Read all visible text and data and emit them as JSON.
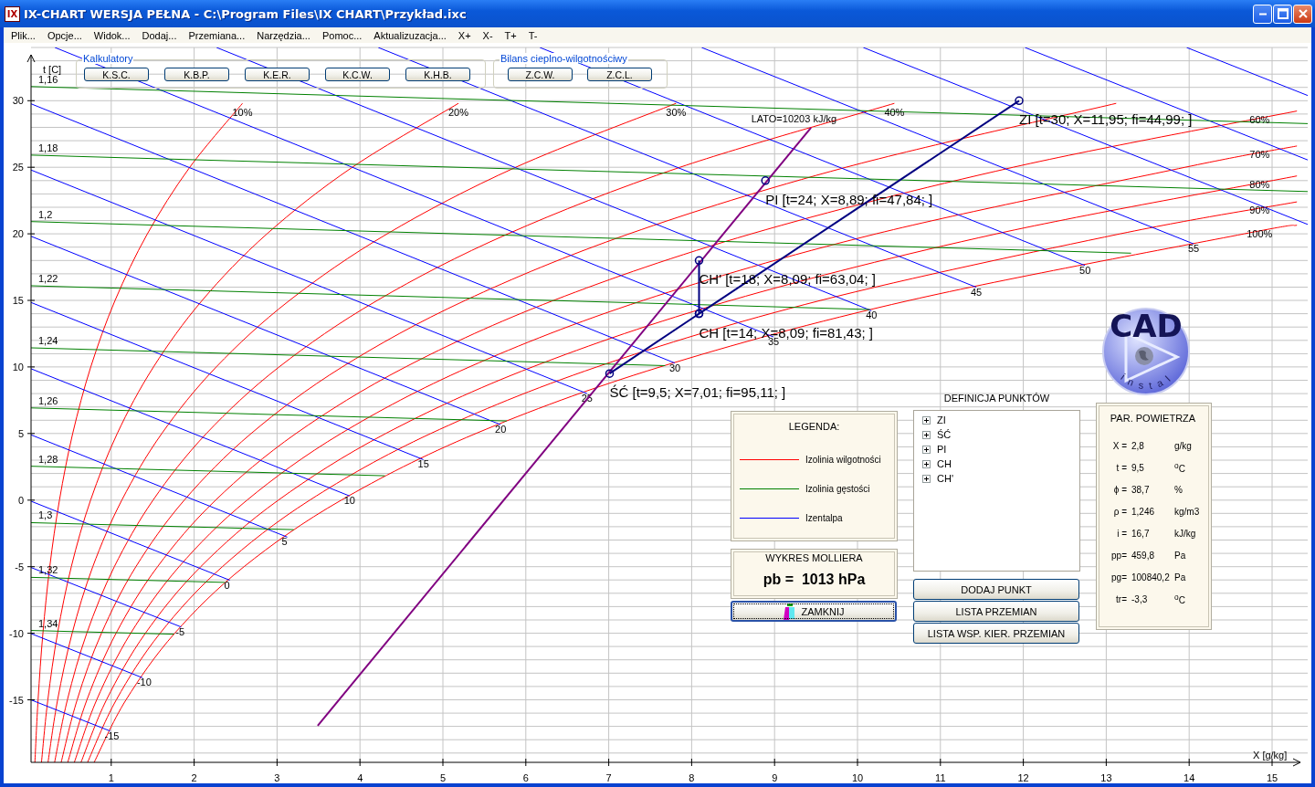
{
  "window": {
    "icon_text": "IX",
    "title": "IX-CHART WERSJA PEŁNA - C:\\Program Files\\IX CHART\\Przykład.ixc"
  },
  "menu": [
    "Plik...",
    "Opcje...",
    "Widok...",
    "Dodaj...",
    "Przemiana...",
    "Narzędzia...",
    "Pomoc...",
    "Aktualizuzacja...",
    "X+",
    "X-",
    "T+",
    "T-"
  ],
  "chart": {
    "chart_data": {
      "type": "line",
      "xlabel": "X [g/kg]",
      "ylabel": "t [C]",
      "xlim": [
        0,
        15.43
      ],
      "ylim": [
        -19.7,
        34
      ],
      "grid": true,
      "xticks": [
        1,
        2,
        3,
        4,
        5,
        6,
        7,
        8,
        9,
        10,
        11,
        12,
        13,
        14,
        15
      ],
      "yticks": [
        -15,
        -10,
        -5,
        0,
        5,
        10,
        15,
        20,
        25,
        30
      ],
      "series": [
        {
          "name": "10%",
          "color": "#ff0000",
          "x": [
            2.583,
            1.9475,
            1.4361,
            1.0468,
            0.7537,
            0.5357,
            0.3753,
            0.2592,
            0.1761,
            0.1177,
            0.0793
          ],
          "values": [
            29.8,
            25,
            20,
            15,
            10,
            5,
            0,
            -5,
            -10,
            -15,
            -19.7
          ]
        },
        {
          "name": "20%",
          "color": "#ff0000",
          "x": [
            5.187,
            3.9072,
            2.8787,
            2.0971,
            1.5101,
            1.0722,
            0.7511,
            0.5186,
            0.3524,
            0.2355,
            0.1586
          ],
          "values": [
            29.8,
            25,
            20,
            15,
            10,
            5,
            0,
            -5,
            -10,
            -15,
            -19.7
          ]
        },
        {
          "name": "30%",
          "color": "#ff0000",
          "x": [
            7.812,
            5.879,
            4.328,
            3.151,
            2.2667,
            1.6098,
            1.1274,
            0.7781,
            0.5288,
            0.3533,
            0.2379
          ],
          "values": [
            29.8,
            25,
            20,
            15,
            10,
            5,
            0,
            -5,
            -10,
            -15,
            -19.7
          ]
        },
        {
          "name": "40%",
          "color": "#ff0000",
          "x": [
            10.445,
            7.8606,
            5.785,
            4.2089,
            3.0256,
            2.1481,
            1.504,
            1.0379,
            0.7052,
            0.4712,
            0.3172
          ],
          "values": [
            29.8,
            25,
            20,
            15,
            10,
            5,
            0,
            -5,
            -10,
            -15,
            -19.7
          ]
        },
        {
          "color": "#ff0000",
          "x": [
            13.12,
            9.8615,
            7.2466,
            5.2695,
            3.7867,
            2.6874,
            1.8811,
            1.2979,
            0.8817,
            0.5891,
            0.3966
          ],
          "values": [
            29.8,
            25,
            20,
            15,
            10,
            5,
            0,
            -5,
            -10,
            -15,
            -19.7
          ]
        },
        {
          "name": "60%",
          "color": "#ff0000",
          "x": [
            15.3,
            11.878,
            8.7218,
            6.3366,
            4.5507,
            3.2282,
            2.2588,
            1.5581,
            1.0583,
            0.7071,
            0.476
          ],
          "values": [
            29.23,
            25,
            20,
            15,
            10,
            5,
            0,
            -5,
            -10,
            -15,
            -19.7
          ]
        },
        {
          "name": "70%",
          "color": "#ff0000",
          "x": [
            15.3,
            13.952,
            10.225,
            7.4158,
            5.3201,
            3.771,
            2.6373,
            1.8184,
            1.2351,
            0.8251,
            0.5555
          ],
          "values": [
            26.6,
            25,
            20,
            15,
            10,
            5,
            0,
            -5,
            -10,
            -15,
            -19.7
          ]
        },
        {
          "name": "80%",
          "color": "#ff0000",
          "x": [
            15.3,
            11.677,
            8.474,
            6.081,
            4.311,
            3.0154,
            2.0793,
            1.4121,
            0.9431,
            0.635
          ],
          "values": [
            24.35,
            20,
            15,
            10,
            5,
            0,
            -5,
            -10,
            -15,
            -19.7
          ]
        },
        {
          "name": "90%",
          "color": "#ff0000",
          "x": [
            15.3,
            13.169,
            9.5585,
            6.8573,
            4.8542,
            3.3942,
            2.3401,
            1.5891,
            1.0613,
            0.7144
          ],
          "values": [
            22.4,
            20,
            15,
            10,
            5,
            0,
            -5,
            -10,
            -15,
            -19.7
          ]
        },
        {
          "name": "100%",
          "color": "#ff0000",
          "x": [
            15.3,
            14.665,
            10.629,
            7.62,
            5.398,
            3.774,
            2.601,
            1.766,
            1.179,
            0.794
          ],
          "values": [
            20.65,
            20,
            15,
            10,
            5,
            0,
            -5,
            -10,
            -15,
            -19.7
          ]
        },
        {
          "name": "-15",
          "color": "#0000ff",
          "x": [
            0.987,
            0
          ],
          "values": [
            -17.35,
            -14.93
          ]
        },
        {
          "name": "-10",
          "color": "#0000ff",
          "x": [
            1.376,
            0
          ],
          "values": [
            -13.34,
            -9.95
          ]
        },
        {
          "name": "-5",
          "color": "#0000ff",
          "x": [
            1.843,
            0
          ],
          "values": [
            -9.53,
            -4.98
          ]
        },
        {
          "name": "0",
          "color": "#0000ff",
          "x": [
            2.43,
            0
          ],
          "values": [
            -6.02,
            0
          ]
        },
        {
          "name": "5",
          "color": "#0000ff",
          "x": [
            3.123,
            0
          ],
          "values": [
            -2.78,
            4.98
          ]
        },
        {
          "name": "10",
          "color": "#0000ff",
          "x": [
            3.873,
            0
          ],
          "values": [
            0.31,
            9.95
          ]
        },
        {
          "name": "15",
          "color": "#0000ff",
          "x": [
            4.765,
            0
          ],
          "values": [
            3.04,
            14.93
          ]
        },
        {
          "name": "20",
          "color": "#0000ff",
          "x": [
            5.695,
            0
          ],
          "values": [
            5.67,
            19.9
          ]
        },
        {
          "name": "25",
          "color": "#0000ff",
          "x": [
            6.737,
            0
          ],
          "values": [
            8.01,
            24.88
          ]
        },
        {
          "name": "30",
          "color": "#0000ff",
          "x": [
            7.797,
            0
          ],
          "values": [
            10.3,
            29.85
          ]
        },
        {
          "name": "35",
          "color": "#0000ff",
          "x": [
            8.986,
            0.32
          ],
          "values": [
            12.26,
            34
          ]
        },
        {
          "name": "40",
          "color": "#0000ff",
          "x": [
            10.168,
            2.27
          ],
          "values": [
            14.23,
            34
          ]
        },
        {
          "name": "45",
          "color": "#0000ff",
          "x": [
            11.432,
            4.22
          ],
          "values": [
            15.99,
            34
          ]
        },
        {
          "name": "50",
          "color": "#0000ff",
          "x": [
            12.744,
            6.17
          ],
          "values": [
            17.62,
            34
          ]
        },
        {
          "name": "55",
          "color": "#0000ff",
          "x": [
            14.053,
            8.12
          ],
          "values": [
            19.25,
            34
          ]
        },
        {
          "color": "#0000ff",
          "x": [
            15.43,
            10.07
          ],
          "values": [
            20.71,
            34
          ]
        },
        {
          "color": "#0000ff",
          "x": [
            15.43,
            12.02
          ],
          "values": [
            25.55,
            34
          ]
        },
        {
          "color": "#0000ff",
          "x": [
            15.43,
            13.97
          ],
          "values": [
            30.39,
            34
          ]
        },
        {
          "name": "1,16",
          "color": "#008000",
          "x": [
            0,
            15.43
          ],
          "values": [
            31.07,
            28.28
          ]
        },
        {
          "name": "1,18",
          "color": "#008000",
          "x": [
            0,
            15.43
          ],
          "values": [
            25.92,
            23.18
          ]
        },
        {
          "name": "1,2",
          "color": "#008000",
          "x": [
            0,
            13.3
          ],
          "values": [
            20.93,
            18.55
          ]
        },
        {
          "name": "1,22",
          "color": "#008000",
          "x": [
            0,
            10.15
          ],
          "values": [
            16.11,
            14.32
          ]
        },
        {
          "name": "1,24",
          "color": "#008000",
          "x": [
            0,
            7.68
          ],
          "values": [
            11.44,
            10.1
          ]
        },
        {
          "name": "1,26",
          "color": "#008000",
          "x": [
            0,
            5.77
          ],
          "values": [
            6.93,
            5.94
          ]
        },
        {
          "name": "1,28",
          "color": "#008000",
          "x": [
            0,
            4.3
          ],
          "values": [
            2.55,
            1.83
          ]
        },
        {
          "name": "1,3",
          "color": "#008000",
          "x": [
            0,
            3.2
          ],
          "values": [
            -1.69,
            -2.22
          ]
        },
        {
          "name": "1,32",
          "color": "#008000",
          "x": [
            0,
            2.37
          ],
          "values": [
            -5.8,
            -6.18
          ]
        },
        {
          "name": "1,34",
          "color": "#008000",
          "x": [
            0,
            1.755
          ],
          "values": [
            -9.79,
            -10.07
          ]
        },
        {
          "color": "#800080",
          "marker": "none",
          "x": [
            3.49,
            9.44
          ],
          "values": [
            -16.94,
            27.98
          ]
        },
        {
          "color": "#000080",
          "marker": "circle",
          "x": [
            11.95,
            8.09,
            7.01
          ],
          "values": [
            30,
            14,
            9.5
          ]
        },
        {
          "color": "#000080",
          "marker": "circle",
          "x": [
            8.09,
            8.09
          ],
          "values": [
            14,
            18
          ]
        },
        {
          "color": "#000080",
          "marker": "circle",
          "x": [
            8.89
          ],
          "values": [
            24
          ]
        }
      ],
      "annotations": [
        {
          "text": "ZI [t=30; X=11,95; fi=44,99; ]",
          "x": 11.95,
          "y": 30
        },
        {
          "text": "PI [t=24; X=8,89; fi=47,84; ]",
          "x": 8.89,
          "y": 24
        },
        {
          "text": "CH' [t=18; X=8,09; fi=63,04; ]",
          "x": 8.09,
          "y": 18
        },
        {
          "text": "CH [t=14; X=8,09; fi=81,43; ]",
          "x": 8.09,
          "y": 14
        },
        {
          "text": "ŚĆ [t=9,5; X=7,01; fi=95,11; ]",
          "x": 7.01,
          "y": 9.5
        },
        "LATO=10203 kJ/kg"
      ]
    }
  },
  "calculators": {
    "title": "Kalkulatory",
    "buttons": [
      "K.S.C.",
      "K.B.P.",
      "K.E.R.",
      "K.C.W.",
      "K.H.B."
    ]
  },
  "balance": {
    "title": "Bilans cieplno-wilgotnościwy",
    "buttons": [
      "Z.C.W.",
      "Z.C.L."
    ]
  },
  "logo": {
    "title": "CAD",
    "subtitle": "instal"
  },
  "legend": {
    "title": "LEGENDA:",
    "items": [
      {
        "label": "Izolinia wilgotności",
        "color": "#ff0000"
      },
      {
        "label": "Izolinia gęstości",
        "color": "#008000"
      },
      {
        "label": "Izentalpa",
        "color": "#0000ff"
      }
    ]
  },
  "diagram": {
    "title": "WYKRES MOLLIERA",
    "value": "pb =  1013 hPa"
  },
  "close_button": {
    "label": "ZAMKNIJ"
  },
  "points": {
    "title": "DEFINICJA PUNKTÓW",
    "items": [
      {
        "label": "ZI",
        "expanded": false
      },
      {
        "label": "ŚĆ",
        "expanded": false
      },
      {
        "label": "PI",
        "expanded": false
      },
      {
        "label": "CH",
        "expanded": false
      },
      {
        "label": "CH'",
        "expanded": false
      }
    ]
  },
  "actions": [
    "DODAJ PUNKT",
    "LISTA PRZEMIAN",
    "LISTA WSP. KIER. PRZEMIAN"
  ],
  "air_parameters": {
    "title": "PAR. POWIETRZA",
    "rows": [
      {
        "name": "X =",
        "value": "2,8",
        "unit": "g/kg"
      },
      {
        "name": "t =",
        "value": "9,5",
        "unit": "$^{o}$C"
      },
      {
        "name": "ϕ =",
        "value": "38,7",
        "unit": "%"
      },
      {
        "name": "ρ =",
        "value": "1,246",
        "unit": "kg/m3"
      },
      {
        "name": "i =",
        "value": "16,7",
        "unit": "kJ/kg"
      },
      {
        "name": "pp=",
        "value": "459,8",
        "unit": "Pa"
      },
      {
        "name": "pg=",
        "value": "100840,2",
        "unit": "Pa"
      },
      {
        "name": "tr=",
        "value": "-3,3",
        "unit": "$^{o}$C"
      }
    ]
  }
}
